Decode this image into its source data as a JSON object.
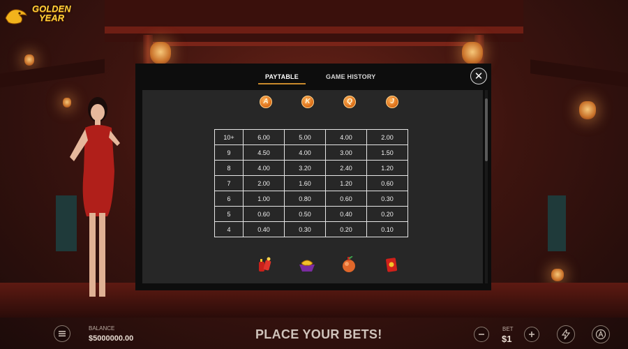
{
  "game": {
    "logo_text_line1": "GOLDEN",
    "logo_text_line2": "YEAR"
  },
  "modal": {
    "tabs": [
      {
        "label": "PAYTABLE",
        "active": true
      },
      {
        "label": "GAME HISTORY",
        "active": false
      }
    ],
    "close_label": "✕",
    "letter_symbols": [
      "A",
      "K",
      "Q",
      "J"
    ],
    "paytable": {
      "rows": [
        {
          "count": "10+",
          "values": [
            "6.00",
            "5.00",
            "4.00",
            "2.00"
          ]
        },
        {
          "count": "9",
          "values": [
            "4.50",
            "4.00",
            "3.00",
            "1.50"
          ]
        },
        {
          "count": "8",
          "values": [
            "4.00",
            "3.20",
            "2.40",
            "1.20"
          ]
        },
        {
          "count": "7",
          "values": [
            "2.00",
            "1.60",
            "1.20",
            "0.60"
          ]
        },
        {
          "count": "6",
          "values": [
            "1.00",
            "0.80",
            "0.60",
            "0.30"
          ]
        },
        {
          "count": "5",
          "values": [
            "0.60",
            "0.50",
            "0.40",
            "0.20"
          ]
        },
        {
          "count": "4",
          "values": [
            "0.40",
            "0.30",
            "0.20",
            "0.10"
          ]
        }
      ]
    },
    "picture_symbols": [
      "firecracker-icon",
      "gold-ingot-icon",
      "lantern-ball-icon",
      "red-envelope-icon"
    ]
  },
  "bottom_bar": {
    "balance_label": "BALANCE",
    "balance_value": "$5000000.00",
    "status_text": "PLACE YOUR BETS!",
    "bet_label": "BET",
    "bet_value": "$1",
    "menu_icon": "menu-icon",
    "minus_icon": "minus-icon",
    "plus_icon": "plus-icon",
    "turbo_icon": "lightning-icon",
    "autoplay_icon": "autoplay-icon"
  },
  "colors": {
    "accent": "#c98a2c",
    "coin": "#d96a14",
    "modal_bg": "#0d0d0d",
    "panel_bg": "#272727"
  }
}
